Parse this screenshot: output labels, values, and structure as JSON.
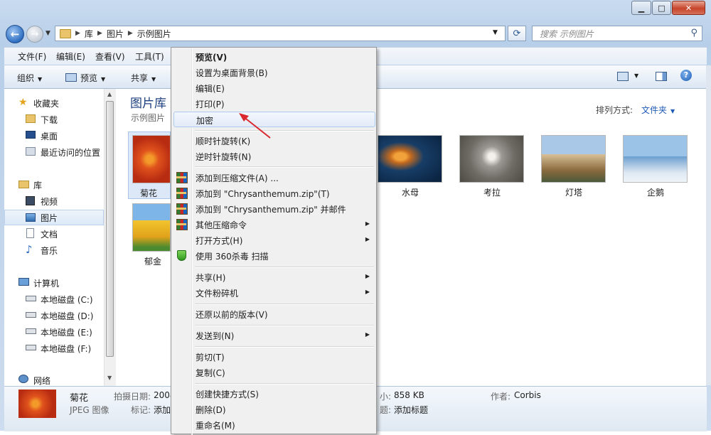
{
  "address": {
    "crumbs": [
      "库",
      "图片",
      "示例图片"
    ]
  },
  "search": {
    "placeholder": "搜索 示例图片"
  },
  "menubar": {
    "items": [
      "文件(F)",
      "编辑(E)",
      "查看(V)",
      "工具(T)"
    ]
  },
  "commandbar": {
    "organize": "组织",
    "preview": "预览",
    "share": "共享"
  },
  "sidebar": {
    "favorites": "收藏夹",
    "downloads": "下载",
    "desktop": "桌面",
    "recent": "最近访问的位置",
    "libraries": "库",
    "videos": "视频",
    "pictures": "图片",
    "documents": "文档",
    "music": "音乐",
    "computer": "计算机",
    "drive_c": "本地磁盘 (C:)",
    "drive_d": "本地磁盘 (D:)",
    "drive_e": "本地磁盘 (E:)",
    "drive_f": "本地磁盘 (F:)",
    "network": "网络"
  },
  "library": {
    "title": "图片库",
    "subtitle": "示例图片",
    "arrange_label": "排列方式:",
    "arrange_value": "文件夹"
  },
  "thumbnails": [
    {
      "name": "菊花",
      "color": "#d9401a"
    },
    {
      "name": "郁金",
      "color": "#e8b829"
    },
    {
      "name": "水母",
      "color": "#1c4a78"
    },
    {
      "name": "考拉",
      "color": "#8c8a86"
    },
    {
      "name": "灯塔",
      "color": "#b58a55"
    },
    {
      "name": "企鹅",
      "color": "#4f7fa8"
    }
  ],
  "details": {
    "name": "菊花",
    "type": "JPEG 图像",
    "date_label": "拍摄日期:",
    "date_value": "2008",
    "tags_label": "标记:",
    "tags_value": "添加",
    "size_label": "小:",
    "size_value": "858 KB",
    "title_label": "题:",
    "title_value": "添加标题",
    "author_label": "作者:",
    "author_value": "Corbis"
  },
  "context_menu": {
    "items": [
      "预览(V)",
      "设置为桌面背景(B)",
      "编辑(E)",
      "打印(P)",
      "加密",
      "顺时针旋转(K)",
      "逆时针旋转(N)",
      "添加到压缩文件(A) ...",
      "添加到 \"Chrysanthemum.zip\"(T)",
      "添加到 \"Chrysanthemum.zip\" 并邮件",
      "其他压缩命令",
      "打开方式(H)",
      "使用 360杀毒 扫描",
      "共享(H)",
      "文件粉碎机",
      "还原以前的版本(V)",
      "发送到(N)",
      "剪切(T)",
      "复制(C)",
      "创建快捷方式(S)",
      "删除(D)",
      "重命名(M)"
    ]
  },
  "colors": {
    "accent": "#1e5bb4",
    "title_blue": "#1e3f7f",
    "annotation_arrow": "#d9292e"
  }
}
